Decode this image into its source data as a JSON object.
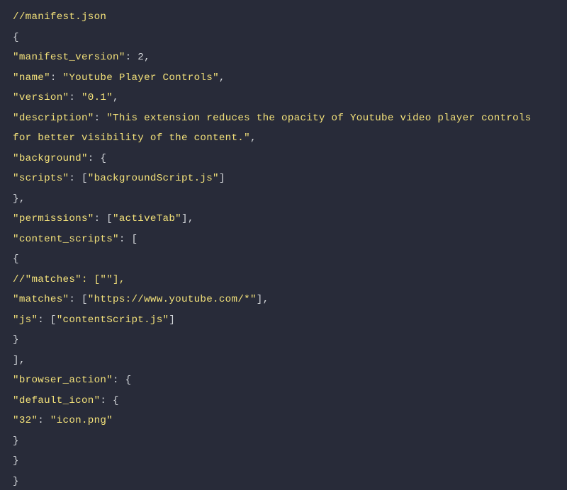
{
  "code": {
    "lines": [
      {
        "segments": [
          {
            "t": "//manifest.json",
            "c": "str"
          }
        ]
      },
      {
        "segments": [
          {
            "t": "{",
            "c": "pn"
          }
        ]
      },
      {
        "segments": [
          {
            "t": "\"manifest_version\"",
            "c": "key"
          },
          {
            "t": ": ",
            "c": "pn"
          },
          {
            "t": "2",
            "c": "num"
          },
          {
            "t": ",",
            "c": "pn"
          }
        ]
      },
      {
        "segments": [
          {
            "t": "\"name\"",
            "c": "key"
          },
          {
            "t": ": ",
            "c": "pn"
          },
          {
            "t": "\"Youtube Player Controls\"",
            "c": "str"
          },
          {
            "t": ",",
            "c": "pn"
          }
        ]
      },
      {
        "segments": [
          {
            "t": "\"version\"",
            "c": "key"
          },
          {
            "t": ": ",
            "c": "pn"
          },
          {
            "t": "\"0.1\"",
            "c": "str"
          },
          {
            "t": ",",
            "c": "pn"
          }
        ]
      },
      {
        "segments": [
          {
            "t": "\"description\"",
            "c": "key"
          },
          {
            "t": ": ",
            "c": "pn"
          },
          {
            "t": "\"This extension reduces the opacity of Youtube video player controls for better visibility of the content.\"",
            "c": "str"
          },
          {
            "t": ",",
            "c": "pn"
          }
        ]
      },
      {
        "segments": [
          {
            "t": "\"background\"",
            "c": "key"
          },
          {
            "t": ": {",
            "c": "pn"
          }
        ]
      },
      {
        "segments": [
          {
            "t": "\"scripts\"",
            "c": "key"
          },
          {
            "t": ": [",
            "c": "pn"
          },
          {
            "t": "\"backgroundScript.js\"",
            "c": "str"
          },
          {
            "t": "]",
            "c": "pn"
          }
        ]
      },
      {
        "segments": [
          {
            "t": "},",
            "c": "pn"
          }
        ]
      },
      {
        "segments": [
          {
            "t": "\"permissions\"",
            "c": "key"
          },
          {
            "t": ": [",
            "c": "pn"
          },
          {
            "t": "\"activeTab\"",
            "c": "str"
          },
          {
            "t": "],",
            "c": "pn"
          }
        ]
      },
      {
        "segments": [
          {
            "t": "\"content_scripts\"",
            "c": "key"
          },
          {
            "t": ": [",
            "c": "pn"
          }
        ]
      },
      {
        "segments": [
          {
            "t": "{",
            "c": "pn"
          }
        ]
      },
      {
        "segments": [
          {
            "t": "//\"matches\": [\"\"],",
            "c": "str"
          }
        ]
      },
      {
        "segments": [
          {
            "t": "\"matches\"",
            "c": "key"
          },
          {
            "t": ": [",
            "c": "pn"
          },
          {
            "t": "\"https://www.youtube.com/*\"",
            "c": "str"
          },
          {
            "t": "],",
            "c": "pn"
          }
        ]
      },
      {
        "segments": [
          {
            "t": "\"js\"",
            "c": "key"
          },
          {
            "t": ": [",
            "c": "pn"
          },
          {
            "t": "\"contentScript.js\"",
            "c": "str"
          },
          {
            "t": "]",
            "c": "pn"
          }
        ]
      },
      {
        "segments": [
          {
            "t": "}",
            "c": "pn"
          }
        ]
      },
      {
        "segments": [
          {
            "t": "],",
            "c": "pn"
          }
        ]
      },
      {
        "segments": [
          {
            "t": "\"browser_action\"",
            "c": "key"
          },
          {
            "t": ": {",
            "c": "pn"
          }
        ]
      },
      {
        "segments": [
          {
            "t": "\"default_icon\"",
            "c": "key"
          },
          {
            "t": ": {",
            "c": "pn"
          }
        ]
      },
      {
        "segments": [
          {
            "t": "\"32\"",
            "c": "key"
          },
          {
            "t": ": ",
            "c": "pn"
          },
          {
            "t": "\"icon.png\"",
            "c": "str"
          }
        ]
      },
      {
        "segments": [
          {
            "t": "}",
            "c": "pn"
          }
        ]
      },
      {
        "segments": [
          {
            "t": "}",
            "c": "pn"
          }
        ]
      },
      {
        "segments": [
          {
            "t": "}",
            "c": "pn"
          }
        ]
      }
    ]
  }
}
